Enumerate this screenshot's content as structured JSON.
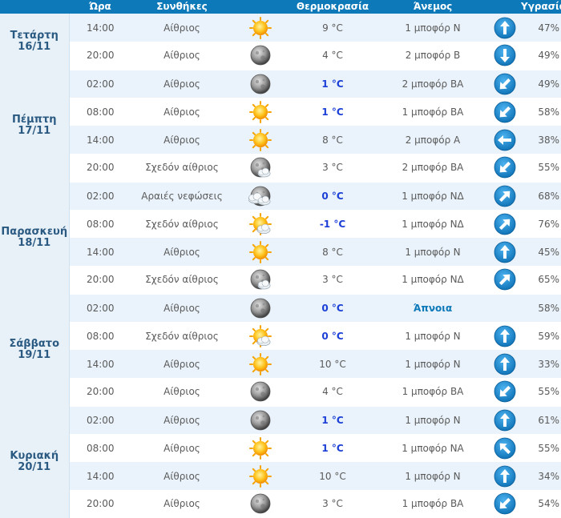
{
  "header": {
    "time": "Ώρα",
    "conditions": "Συνθήκες",
    "temperature": "Θερμοκρασία",
    "wind": "Άνεμος",
    "humidity": "Υγρασία"
  },
  "colors": {
    "header_bg": "#0e79b8",
    "cold_temp": "#1b3fd6",
    "arrow": "#1c8fd6"
  },
  "days": [
    {
      "name": "Τετάρτη",
      "date": "16/11",
      "rows": [
        {
          "time": "14:00",
          "cond": "Αίθριος",
          "icon": "sun-icon",
          "temp": "9 °C",
          "cold": false,
          "wind": "1 μποφόρ Ν",
          "dir": "N",
          "hum": "47%"
        },
        {
          "time": "20:00",
          "cond": "Αίθριος",
          "icon": "moon-icon",
          "temp": "4 °C",
          "cold": false,
          "wind": "2 μποφόρ Β",
          "dir": "S",
          "hum": "49%"
        }
      ]
    },
    {
      "name": "Πέμπτη",
      "date": "17/11",
      "rows": [
        {
          "time": "02:00",
          "cond": "Αίθριος",
          "icon": "moon-icon",
          "temp": "1 °C",
          "cold": true,
          "wind": "2 μποφόρ ΒΑ",
          "dir": "SW",
          "hum": "49%"
        },
        {
          "time": "08:00",
          "cond": "Αίθριος",
          "icon": "sun-icon",
          "temp": "1 °C",
          "cold": true,
          "wind": "1 μποφόρ ΒΑ",
          "dir": "SW",
          "hum": "58%"
        },
        {
          "time": "14:00",
          "cond": "Αίθριος",
          "icon": "sun-icon",
          "temp": "8 °C",
          "cold": false,
          "wind": "2 μποφόρ Α",
          "dir": "W",
          "hum": "38%"
        },
        {
          "time": "20:00",
          "cond": "Σχεδόν αίθριος",
          "icon": "moon-cloud-icon",
          "temp": "3 °C",
          "cold": false,
          "wind": "2 μποφόρ ΒΑ",
          "dir": "SW",
          "hum": "55%"
        }
      ]
    },
    {
      "name": "Παρασκευή",
      "date": "18/11",
      "rows": [
        {
          "time": "02:00",
          "cond": "Αραιές νεφώσεις",
          "icon": "moon-clouds-icon",
          "temp": "0 °C",
          "cold": true,
          "wind": "1 μποφόρ ΝΔ",
          "dir": "NE",
          "hum": "68%"
        },
        {
          "time": "08:00",
          "cond": "Σχεδόν αίθριος",
          "icon": "sun-cloud-icon",
          "temp": "-1 °C",
          "cold": true,
          "wind": "1 μποφόρ ΝΔ",
          "dir": "NE",
          "hum": "76%"
        },
        {
          "time": "14:00",
          "cond": "Αίθριος",
          "icon": "sun-icon",
          "temp": "8 °C",
          "cold": false,
          "wind": "1 μποφόρ Ν",
          "dir": "N",
          "hum": "45%"
        },
        {
          "time": "20:00",
          "cond": "Σχεδόν αίθριος",
          "icon": "moon-cloud-icon",
          "temp": "3 °C",
          "cold": false,
          "wind": "1 μποφόρ ΝΔ",
          "dir": "NE",
          "hum": "65%"
        }
      ]
    },
    {
      "name": "Σάββατο",
      "date": "19/11",
      "rows": [
        {
          "time": "02:00",
          "cond": "Αίθριος",
          "icon": "moon-icon",
          "temp": "0 °C",
          "cold": true,
          "wind": "Άπνοια",
          "calm": true,
          "dir": "",
          "hum": "58%"
        },
        {
          "time": "08:00",
          "cond": "Σχεδόν αίθριος",
          "icon": "sun-cloud-icon",
          "temp": "0 °C",
          "cold": true,
          "wind": "1 μποφόρ Ν",
          "dir": "N",
          "hum": "59%"
        },
        {
          "time": "14:00",
          "cond": "Αίθριος",
          "icon": "sun-icon",
          "temp": "10 °C",
          "cold": false,
          "wind": "1 μποφόρ Ν",
          "dir": "N",
          "hum": "33%"
        },
        {
          "time": "20:00",
          "cond": "Αίθριος",
          "icon": "moon-icon",
          "temp": "4 °C",
          "cold": false,
          "wind": "1 μποφόρ ΒΑ",
          "dir": "SW",
          "hum": "55%"
        }
      ]
    },
    {
      "name": "Κυριακή",
      "date": "20/11",
      "rows": [
        {
          "time": "02:00",
          "cond": "Αίθριος",
          "icon": "moon-icon",
          "temp": "1 °C",
          "cold": true,
          "wind": "1 μποφόρ Ν",
          "dir": "N",
          "hum": "61%"
        },
        {
          "time": "08:00",
          "cond": "Αίθριος",
          "icon": "sun-icon",
          "temp": "1 °C",
          "cold": true,
          "wind": "1 μποφόρ ΝΑ",
          "dir": "NW",
          "hum": "55%"
        },
        {
          "time": "14:00",
          "cond": "Αίθριος",
          "icon": "sun-icon",
          "temp": "10 °C",
          "cold": false,
          "wind": "1 μποφόρ Ν",
          "dir": "N",
          "hum": "34%"
        },
        {
          "time": "20:00",
          "cond": "Αίθριος",
          "icon": "moon-icon",
          "temp": "3 °C",
          "cold": false,
          "wind": "1 μποφόρ ΒΑ",
          "dir": "SW",
          "hum": "54%"
        }
      ]
    }
  ]
}
